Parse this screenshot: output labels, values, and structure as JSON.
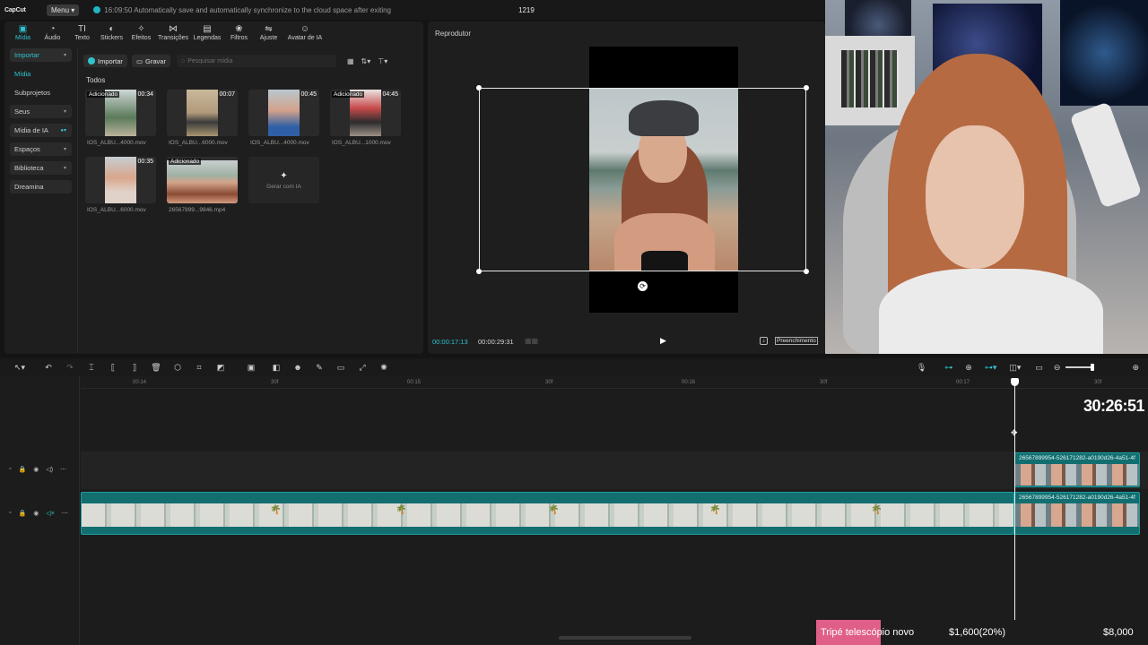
{
  "app": {
    "logo": "CapCut",
    "menu_label": "Menu",
    "save_status": "16:09:50 Automatically save and automatically synchronize to the cloud space after exiting",
    "project_name": "1219"
  },
  "tabs": [
    {
      "label": "Mídia",
      "icon": "media-icon"
    },
    {
      "label": "Áudio",
      "icon": "audio-icon"
    },
    {
      "label": "Texto",
      "icon": "text-icon"
    },
    {
      "label": "Stickers",
      "icon": "sticker-icon"
    },
    {
      "label": "Efeitos",
      "icon": "effects-icon"
    },
    {
      "label": "Transições",
      "icon": "transitions-icon"
    },
    {
      "label": "Legendas",
      "icon": "captions-icon"
    },
    {
      "label": "Filtros",
      "icon": "filters-icon"
    },
    {
      "label": "Ajuste",
      "icon": "adjust-icon"
    },
    {
      "label": "Avatar de IA",
      "icon": "ai-avatar-icon"
    }
  ],
  "sidebar": {
    "items": [
      {
        "label": "Importar"
      },
      {
        "label": "Mídia"
      },
      {
        "label": "Subprojetos"
      },
      {
        "label": "Seus"
      },
      {
        "label": "Mídia de IA"
      },
      {
        "label": "Espaços"
      },
      {
        "label": "Biblioteca"
      },
      {
        "label": "Dreamina"
      }
    ]
  },
  "media_toolbar": {
    "import_label": "Importar",
    "record_label": "Gravar",
    "search_placeholder": "Pesquisar mídia"
  },
  "media": {
    "section_label": "Todos",
    "items": [
      {
        "name": "IOS_ALBU...4000.mov",
        "duration": "00:34",
        "tag": "Adicionado"
      },
      {
        "name": "IOS_ALBU...6000.mov",
        "duration": "00:07",
        "tag": ""
      },
      {
        "name": "IOS_ALBU...4000.mov",
        "duration": "00:45",
        "tag": ""
      },
      {
        "name": "IOS_ALBU...1000.mov",
        "duration": "04:45",
        "tag": "Adicionado"
      },
      {
        "name": "IOS_ALBU...6000.mov",
        "duration": "00:35",
        "tag": ""
      },
      {
        "name": "26567899...9846.mp4",
        "duration": "",
        "tag": "Adicionado"
      }
    ],
    "generate_label": "Gerar com IA"
  },
  "player": {
    "title": "Reprodutor",
    "current_time": "00:00:17:13",
    "total_time": "00:00:29:31",
    "ratio_label": "Preenchimento"
  },
  "timeline": {
    "ruler_labels": [
      "00:14",
      "30f",
      "00:15",
      "30f",
      "00:16",
      "30f",
      "00:17",
      "30f"
    ],
    "clip_top_title": "26567899954-526171282-a0190d26-4a51-4f",
    "clip_bottom_title": "26567899954-526171282-a0190d26-4a51-4f",
    "overlay_timer": "30:26:51"
  },
  "overlay": {
    "goal_label": "Tripé telescópio novo",
    "goal_progress": "$1,600(20%)",
    "goal_target": "$8,000",
    "goal_fraction": 0.2
  },
  "colors": {
    "accent": "#2fc3d0",
    "clip": "#136e70",
    "goal": "#e05f88"
  }
}
